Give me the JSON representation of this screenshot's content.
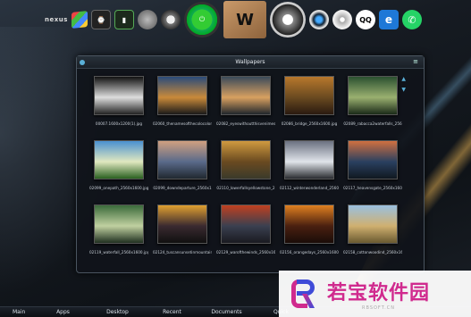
{
  "dock": {
    "items": [
      {
        "name": "nexus-logo",
        "label": "nexus"
      },
      {
        "name": "windows-start-icon",
        "label": ""
      },
      {
        "name": "clock-icon",
        "label": ""
      },
      {
        "name": "battery-icon",
        "label": ""
      },
      {
        "name": "settings-gear-icon",
        "label": ""
      },
      {
        "name": "ring-icon",
        "label": ""
      },
      {
        "name": "power-icon",
        "label": ""
      },
      {
        "name": "package-box-icon",
        "label": "W"
      },
      {
        "name": "headphones-icon",
        "label": ""
      },
      {
        "name": "camera-icon",
        "label": ""
      },
      {
        "name": "disc-icon",
        "label": ""
      },
      {
        "name": "qq-icon",
        "label": "QQ"
      },
      {
        "name": "edge-icon",
        "label": "e"
      },
      {
        "name": "whatsapp-icon",
        "label": "✆"
      }
    ]
  },
  "window": {
    "title": "Wallpapers"
  },
  "wallpapers": [
    {
      "caption": "00007.1600x1200(1).jpg",
      "colors": [
        "#111",
        "#ddd",
        "#222"
      ]
    },
    {
      "caption": "02060_thenamesofthecolocoloredi",
      "colors": [
        "#2a4b7a",
        "#c98a3a",
        "#1a1a1a"
      ]
    },
    {
      "caption": "02082_eyeswithoutthisvenimes",
      "colors": [
        "#3a4a5a",
        "#d8a060",
        "#20262c"
      ]
    },
    {
      "caption": "02086_bridge_2560x1600.jpg",
      "colors": [
        "#b8782c",
        "#6a4a20",
        "#2a1a10"
      ]
    },
    {
      "caption": "02089_rabacca2waterfalls_256",
      "colors": [
        "#2a5030",
        "#9ab070",
        "#1a2a18"
      ]
    },
    {
      "caption": "02099_onepath_2560x1600.jpg",
      "colors": [
        "#4a90d0",
        "#e0e8c0",
        "#2a6020"
      ]
    },
    {
      "caption": "02099_downdeparture_2560x1",
      "colors": [
        "#d0a080",
        "#5a6a8a",
        "#202830"
      ]
    },
    {
      "caption": "02110_lowerfallsyellowstone_2",
      "colors": [
        "#d09a40",
        "#6a4a20",
        "#3a3a2a"
      ]
    },
    {
      "caption": "02112_winterwonderland_2560x",
      "colors": [
        "#6a7080",
        "#e0e4ea",
        "#2a2c30"
      ]
    },
    {
      "caption": "02117_heavensgate_2560x160",
      "colors": [
        "#d07040",
        "#2a4060",
        "#101820"
      ]
    },
    {
      "caption": "02119_waterfall_2560x1600.jpg",
      "colors": [
        "#3a6a3a",
        "#c0d0a0",
        "#203020"
      ]
    },
    {
      "caption": "02124_tuscansunsetinmountains",
      "colors": [
        "#e0a030",
        "#3a2a30",
        "#101010"
      ]
    },
    {
      "caption": "02129_warofthewinds_2560x16",
      "colors": [
        "#c04020",
        "#3a4050",
        "#1a1a20"
      ]
    },
    {
      "caption": "02156_orangedays_2560x1600",
      "colors": [
        "#e08020",
        "#4a2010",
        "#1a0c08"
      ]
    },
    {
      "caption": "02158_cottonwoodind_2560x16",
      "colors": [
        "#9ac0e0",
        "#d0b070",
        "#6a5a30"
      ]
    }
  ],
  "taskbar": {
    "items": [
      "Main",
      "Apps",
      "Desktop",
      "Recent",
      "Documents",
      "Quick"
    ]
  },
  "watermark": {
    "text": "若宝软件园",
    "url": "RBSOFT.CN"
  },
  "colors": {
    "accent": "#5ab0d8",
    "watermark_pink": "#d02a8e",
    "watermark_blue": "#3f4bd8"
  }
}
